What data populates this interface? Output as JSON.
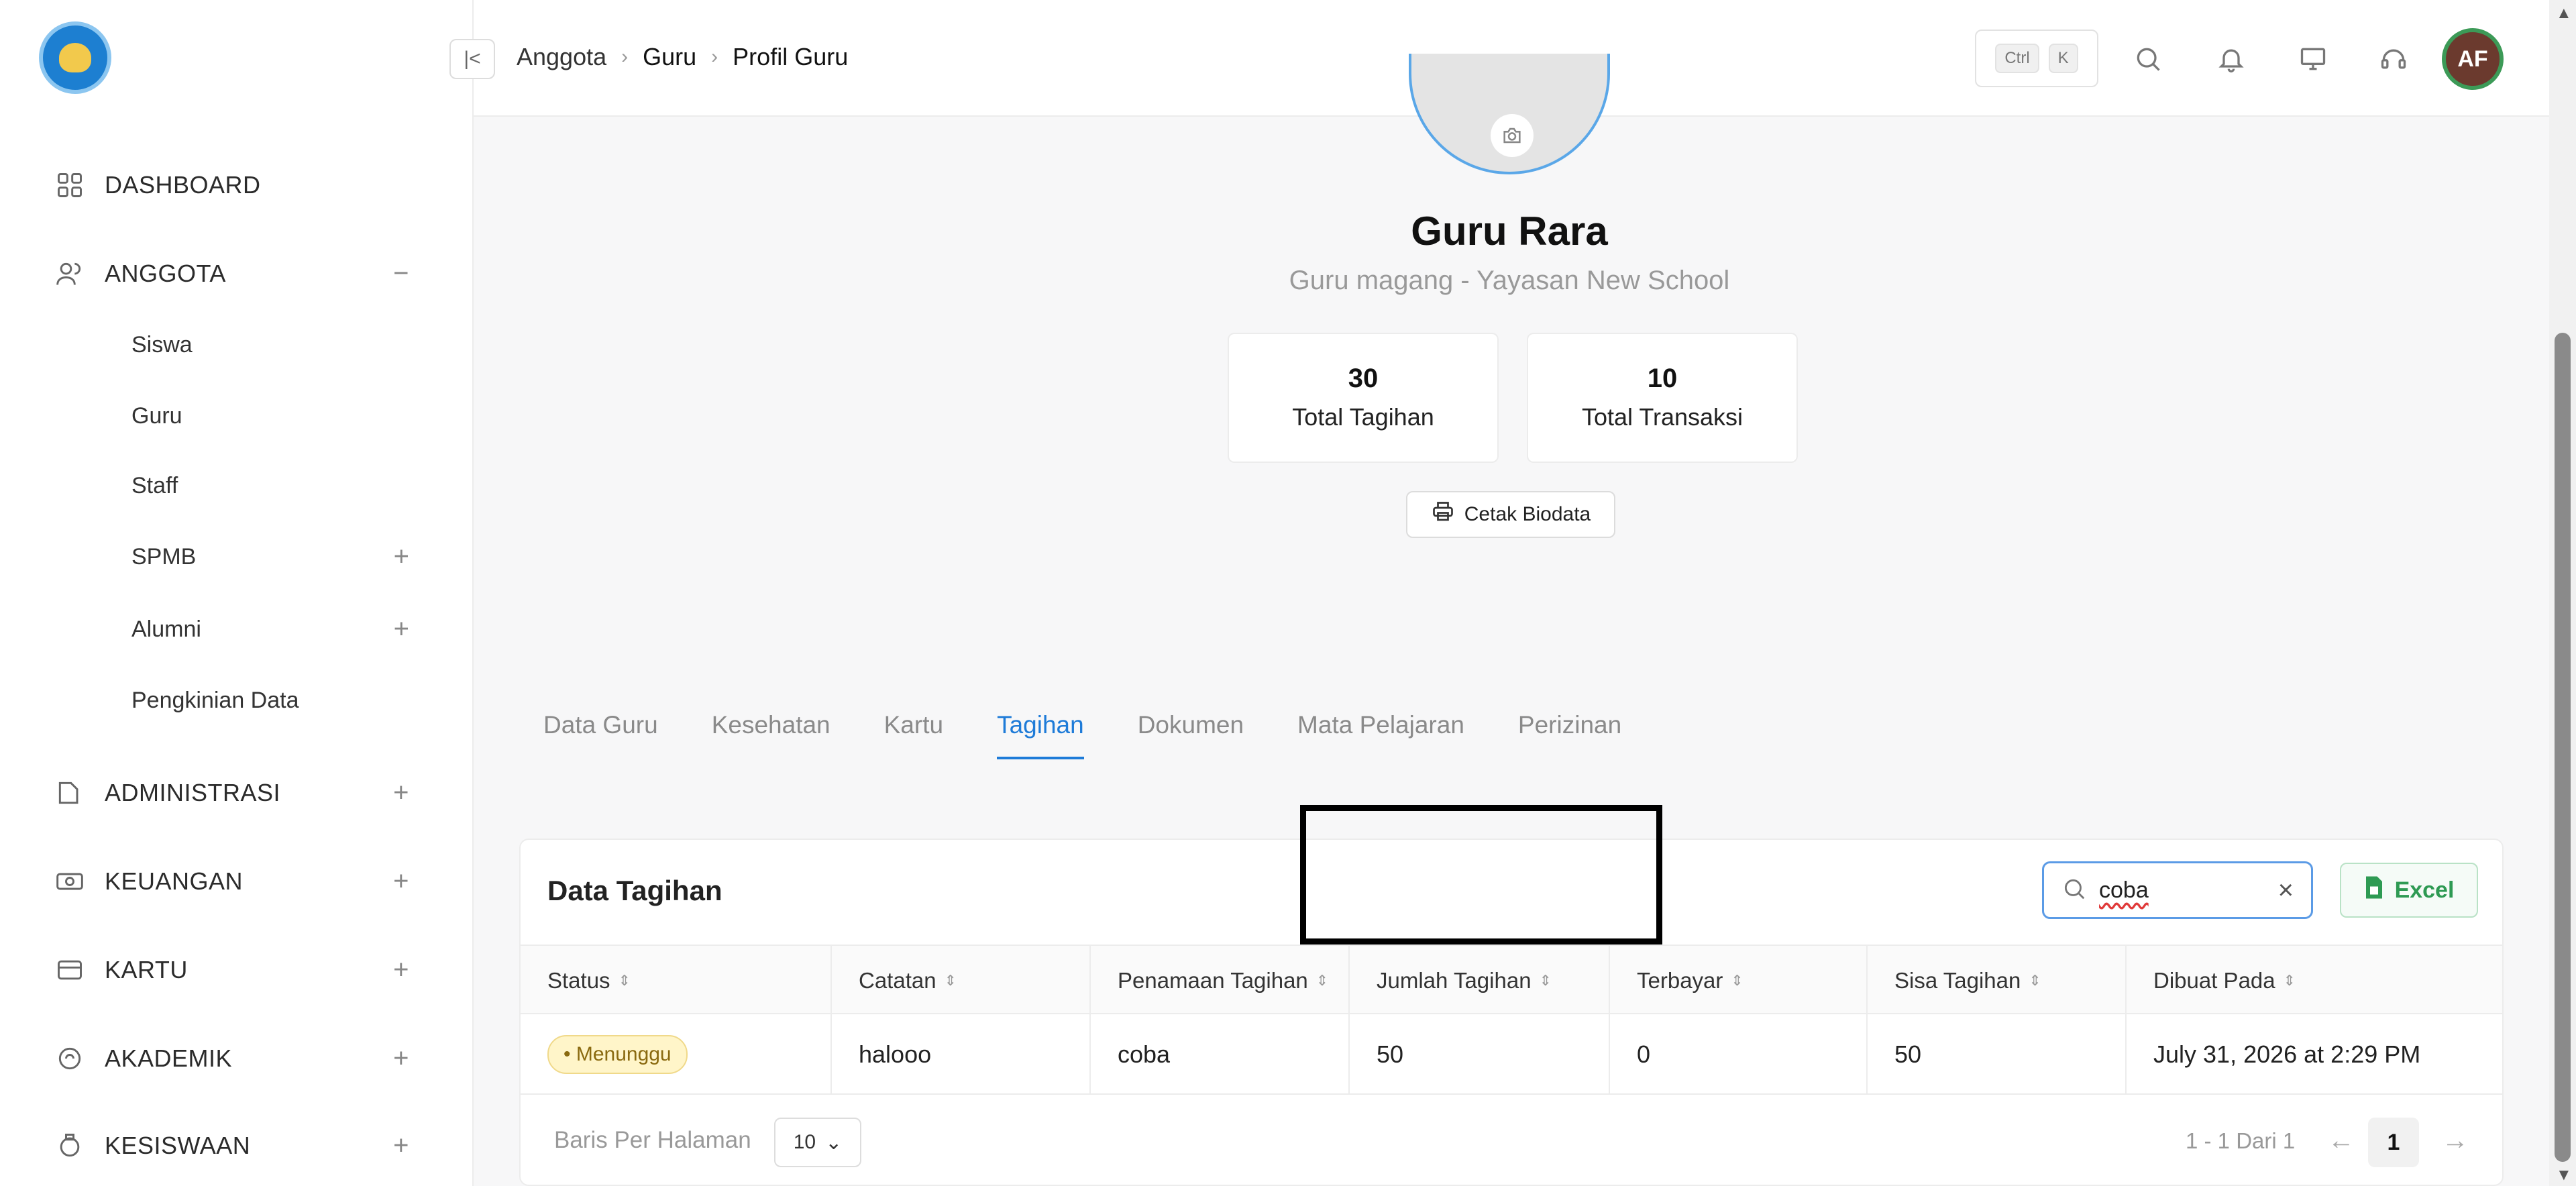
{
  "sidebar": {
    "items": [
      {
        "label": "DASHBOARD",
        "icon": "grid-icon"
      },
      {
        "label": "ANGGOTA",
        "icon": "users-icon",
        "toggle": "−"
      },
      {
        "label": "ADMINISTRASI",
        "icon": "folder-icon",
        "toggle": "+"
      },
      {
        "label": "KEUANGAN",
        "icon": "money-icon",
        "toggle": "+"
      },
      {
        "label": "KARTU",
        "icon": "card-icon",
        "toggle": "+"
      },
      {
        "label": "AKADEMIK",
        "icon": "academic-icon",
        "toggle": "+"
      },
      {
        "label": "KESISWAAN",
        "icon": "student-icon",
        "toggle": "+"
      }
    ],
    "subitems": [
      {
        "label": "Siswa"
      },
      {
        "label": "Guru"
      },
      {
        "label": "Staff"
      },
      {
        "label": "SPMB",
        "toggle": "+"
      },
      {
        "label": "Alumni",
        "toggle": "+"
      },
      {
        "label": "Pengkinian Data"
      }
    ]
  },
  "header": {
    "breadcrumb": [
      "Anggota",
      "Guru",
      "Profil Guru"
    ],
    "kbd": [
      "Ctrl",
      "K"
    ],
    "avatar_initials": "AF"
  },
  "profile": {
    "name": "Guru Rara",
    "role": "Guru magang - Yayasan New School",
    "stats": [
      {
        "value": "30",
        "label": "Total Tagihan"
      },
      {
        "value": "10",
        "label": "Total Transaksi"
      }
    ],
    "print_label": "Cetak Biodata"
  },
  "tabs": [
    "Data Guru",
    "Kesehatan",
    "Kartu",
    "Tagihan",
    "Dokumen",
    "Mata Pelajaran",
    "Perizinan"
  ],
  "active_tab": "Tagihan",
  "table": {
    "title": "Data Tagihan",
    "search_value": "coba",
    "excel_label": "Excel",
    "columns": [
      "Status",
      "Catatan",
      "Penamaan Tagihan",
      "Jumlah Tagihan",
      "Terbayar",
      "Sisa Tagihan",
      "Dibuat Pada"
    ],
    "rows": [
      {
        "status": "• Menunggu",
        "catatan": "halooo",
        "penamaan": "coba",
        "jumlah": "50",
        "terbayar": "0",
        "sisa": "50",
        "dibuat": "July 31, 2026 at 2:29 PM"
      }
    ],
    "rows_per_page_label": "Baris Per Halaman",
    "rows_per_page": "10",
    "page_info": "1 - 1 Dari 1",
    "current_page": "1"
  },
  "colors": {
    "accent": "#1e7bd8",
    "excel": "#2e9a53",
    "badge_bg": "#fff5c9"
  }
}
